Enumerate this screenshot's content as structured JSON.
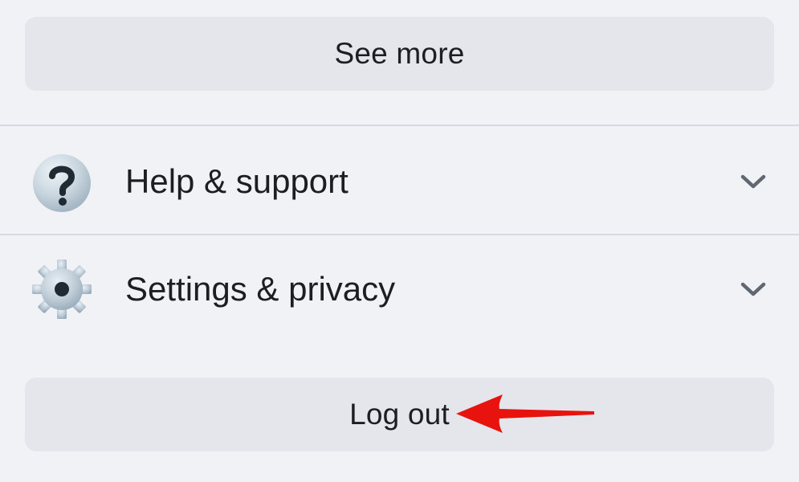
{
  "menu": {
    "see_more_label": "See more",
    "items": [
      {
        "label": "Help & support",
        "icon": "question-mark-icon"
      },
      {
        "label": "Settings & privacy",
        "icon": "gear-icon"
      }
    ],
    "logout_label": "Log out"
  },
  "annotation": {
    "arrow_color": "#e8130f"
  },
  "colors": {
    "background": "#f0f2f5",
    "button": "#e4e6eb",
    "text": "#1c1e21",
    "icon": "#606770"
  }
}
